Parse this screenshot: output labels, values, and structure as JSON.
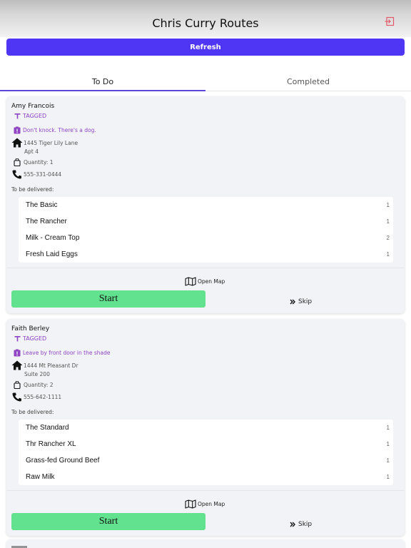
{
  "header": {
    "title": "Chris Curry Routes",
    "logout_icon": "logout-icon"
  },
  "toolbar": {
    "refresh_label": "Refresh"
  },
  "tabs": [
    {
      "label": "To Do",
      "active": true
    },
    {
      "label": "Completed",
      "active": false
    }
  ],
  "orders": [
    {
      "name": "Amy Francois",
      "tag": "TAGGED",
      "note": "Don't knock. There's a dog.",
      "address_line1": "1445 Tiger Lily Lane",
      "address_line2": "Apt 4",
      "quantity": "Quantity: 1",
      "phone": "555-331-0444",
      "deliver_label": "To be delivered:",
      "items": [
        {
          "name": "The Basic",
          "qty": "1"
        },
        {
          "name": "The Rancher",
          "qty": "1"
        },
        {
          "name": "Milk - Cream Top",
          "qty": "2"
        },
        {
          "name": "Fresh Laid Eggs",
          "qty": "1"
        }
      ],
      "open_map": "Open Map",
      "start": "Start",
      "skip": "Skip"
    },
    {
      "name": "Faith Berley",
      "tag": "TAGGED",
      "note": "Leave by front door in the shade",
      "address_line1": "1444 Mt Pleasant Dr",
      "address_line2": "Suite 200",
      "quantity": "Quantity: 2",
      "phone": "555-642-1111",
      "deliver_label": "To be delivered:",
      "items": [
        {
          "name": "The Standard",
          "qty": "1"
        },
        {
          "name": "Thr Rancher XL",
          "qty": "1"
        },
        {
          "name": "Grass-fed Ground Beef",
          "qty": "1"
        },
        {
          "name": "Raw Milk",
          "qty": "1"
        }
      ],
      "open_map": "Open Map",
      "start": "Start",
      "skip": "Skip"
    }
  ],
  "colors": {
    "accent": "#4f36f5",
    "tag": "#8e44c4",
    "start": "#62e18f",
    "logout": "#e05a6a"
  }
}
